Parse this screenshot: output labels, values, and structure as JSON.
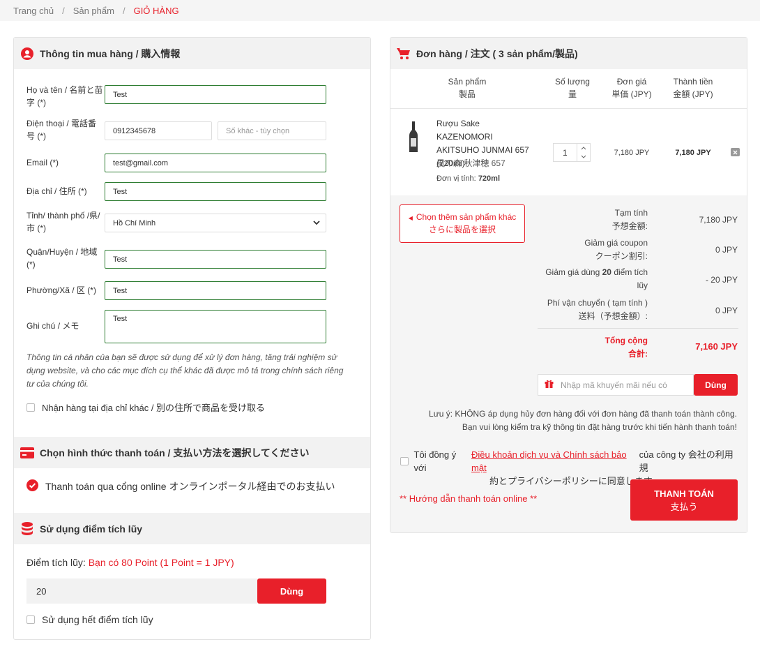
{
  "breadcrumb": {
    "home": "Trang chủ",
    "products": "Sản phẩm",
    "current": "GIỎ HÀNG"
  },
  "buyer": {
    "title": "Thông tin mua hàng / 購入情報",
    "name_label": "Họ và tên / 名前と苗字 (*)",
    "name_value": "Test",
    "phone_label": "Điện thoại / 電話番号 (*)",
    "phone_value": "0912345678",
    "phone2_placeholder": "Số khác - tùy chọn",
    "email_label": "Email (*)",
    "email_value": "test@gmail.com",
    "address_label": "Địa chỉ / 住所 (*)",
    "address_value": "Test",
    "province_label": "Tỉnh/ thành phố /県/市 (*)",
    "province_value": "Hồ Chí Minh",
    "district_label": "Quận/Huyện / 地域 (*)",
    "district_value": "Test",
    "ward_label": "Phường/Xã / 区 (*)",
    "ward_value": "Test",
    "note_label": "Ghi chú / メモ",
    "note_value": "Test",
    "privacy_text": "Thông tin cá nhân của bạn sẽ được sử dụng để xử lý đơn hàng, tăng trải nghiệm sử dụng website, và cho các mục đích cụ thể khác đã được mô tả trong chính sách riêng tư của chúng tôi.",
    "other_address_label": "Nhận hàng tại địa chỉ khác / 別の住所で商品を受け取る"
  },
  "payment": {
    "title": "Chọn hình thức thanh toán / 支払い方法を選択してください",
    "option_label": "Thanh toán qua cổng online オンラインポータル経由でのお支払い"
  },
  "points": {
    "title": "Sử dụng điểm tích lũy",
    "label": "Điểm tích lũy:",
    "available": "Bạn có 80 Point (1 Point = 1 JPY)",
    "input_value": "20",
    "apply_button": "Dùng",
    "use_all_label": "Sử dụng hết điểm tích lũy"
  },
  "order": {
    "title": "Đơn hàng / 注文 ( 3 sản phẩm/製品)",
    "col_product": "Sản phẩm",
    "col_product_jp": "製品",
    "col_qty": "Số lượng",
    "col_qty_jp": "量",
    "col_price": "Đơn giá",
    "col_price_jp": "単価 (JPY)",
    "col_total": "Thành tiền",
    "col_total_jp": "金額 (JPY)",
    "item": {
      "name": "Rượu Sake KAZENOMORI AKITSUHO JUNMAI 657 (720ml)",
      "name_jp": "風の森 秋津穂 657",
      "unit_label": "Đơn vị tính:",
      "unit_value": "720ml",
      "qty": "1",
      "price": "7,180 JPY",
      "total": "7,180 JPY"
    },
    "more_products": "Chọn thêm sản phẩm khác",
    "more_products_jp": "さらに製品を選択",
    "subtotal_label": "Tạm tính",
    "subtotal_label_jp": "予想金額:",
    "subtotal_value": "7,180 JPY",
    "coupon_label": "Giảm giá coupon",
    "coupon_label_jp": "クーポン割引:",
    "coupon_value": "0 JPY",
    "points_discount_label_a": "Giảm giá dùng",
    "points_discount_points": "20",
    "points_discount_label_b": "điểm tích",
    "points_discount_label_c": "lũy",
    "points_discount_value": "- 20 JPY",
    "shipping_label": "Phí vận chuyển ( tạm tính )",
    "shipping_label_jp": "送料（予想金額）:",
    "shipping_value": "0 JPY",
    "total_label": "Tổng cộng",
    "total_label_jp": "合計:",
    "total_value": "7,160 JPY",
    "promo_placeholder": "Nhập mã khuyến mãi nếu có",
    "promo_button": "Dùng",
    "notice_line1": "Lưu ý: KHÔNG áp dụng hủy đơn hàng đối với đơn hàng đã thanh toán thành công.",
    "notice_line2": "Bạn vui lòng kiểm tra kỹ thông tin đặt hàng trước khi tiến hành thanh toán!",
    "agree_prefix": "Tôi đồng ý với",
    "agree_link": "Điều khoản dịch vụ và Chính sách bảo mật",
    "agree_suffix": "của công ty 会社の利用規",
    "agree_line2": "約とプライバシーポリシーに同意します",
    "guide_link": "** Hướng dẫn thanh toán online **",
    "checkout_label": "THANH TOÁN",
    "checkout_label_jp": "支払う"
  },
  "colors": {
    "accent": "#e8202a",
    "input_border": "#2e7d32",
    "header_bg": "#f2f2f2"
  }
}
